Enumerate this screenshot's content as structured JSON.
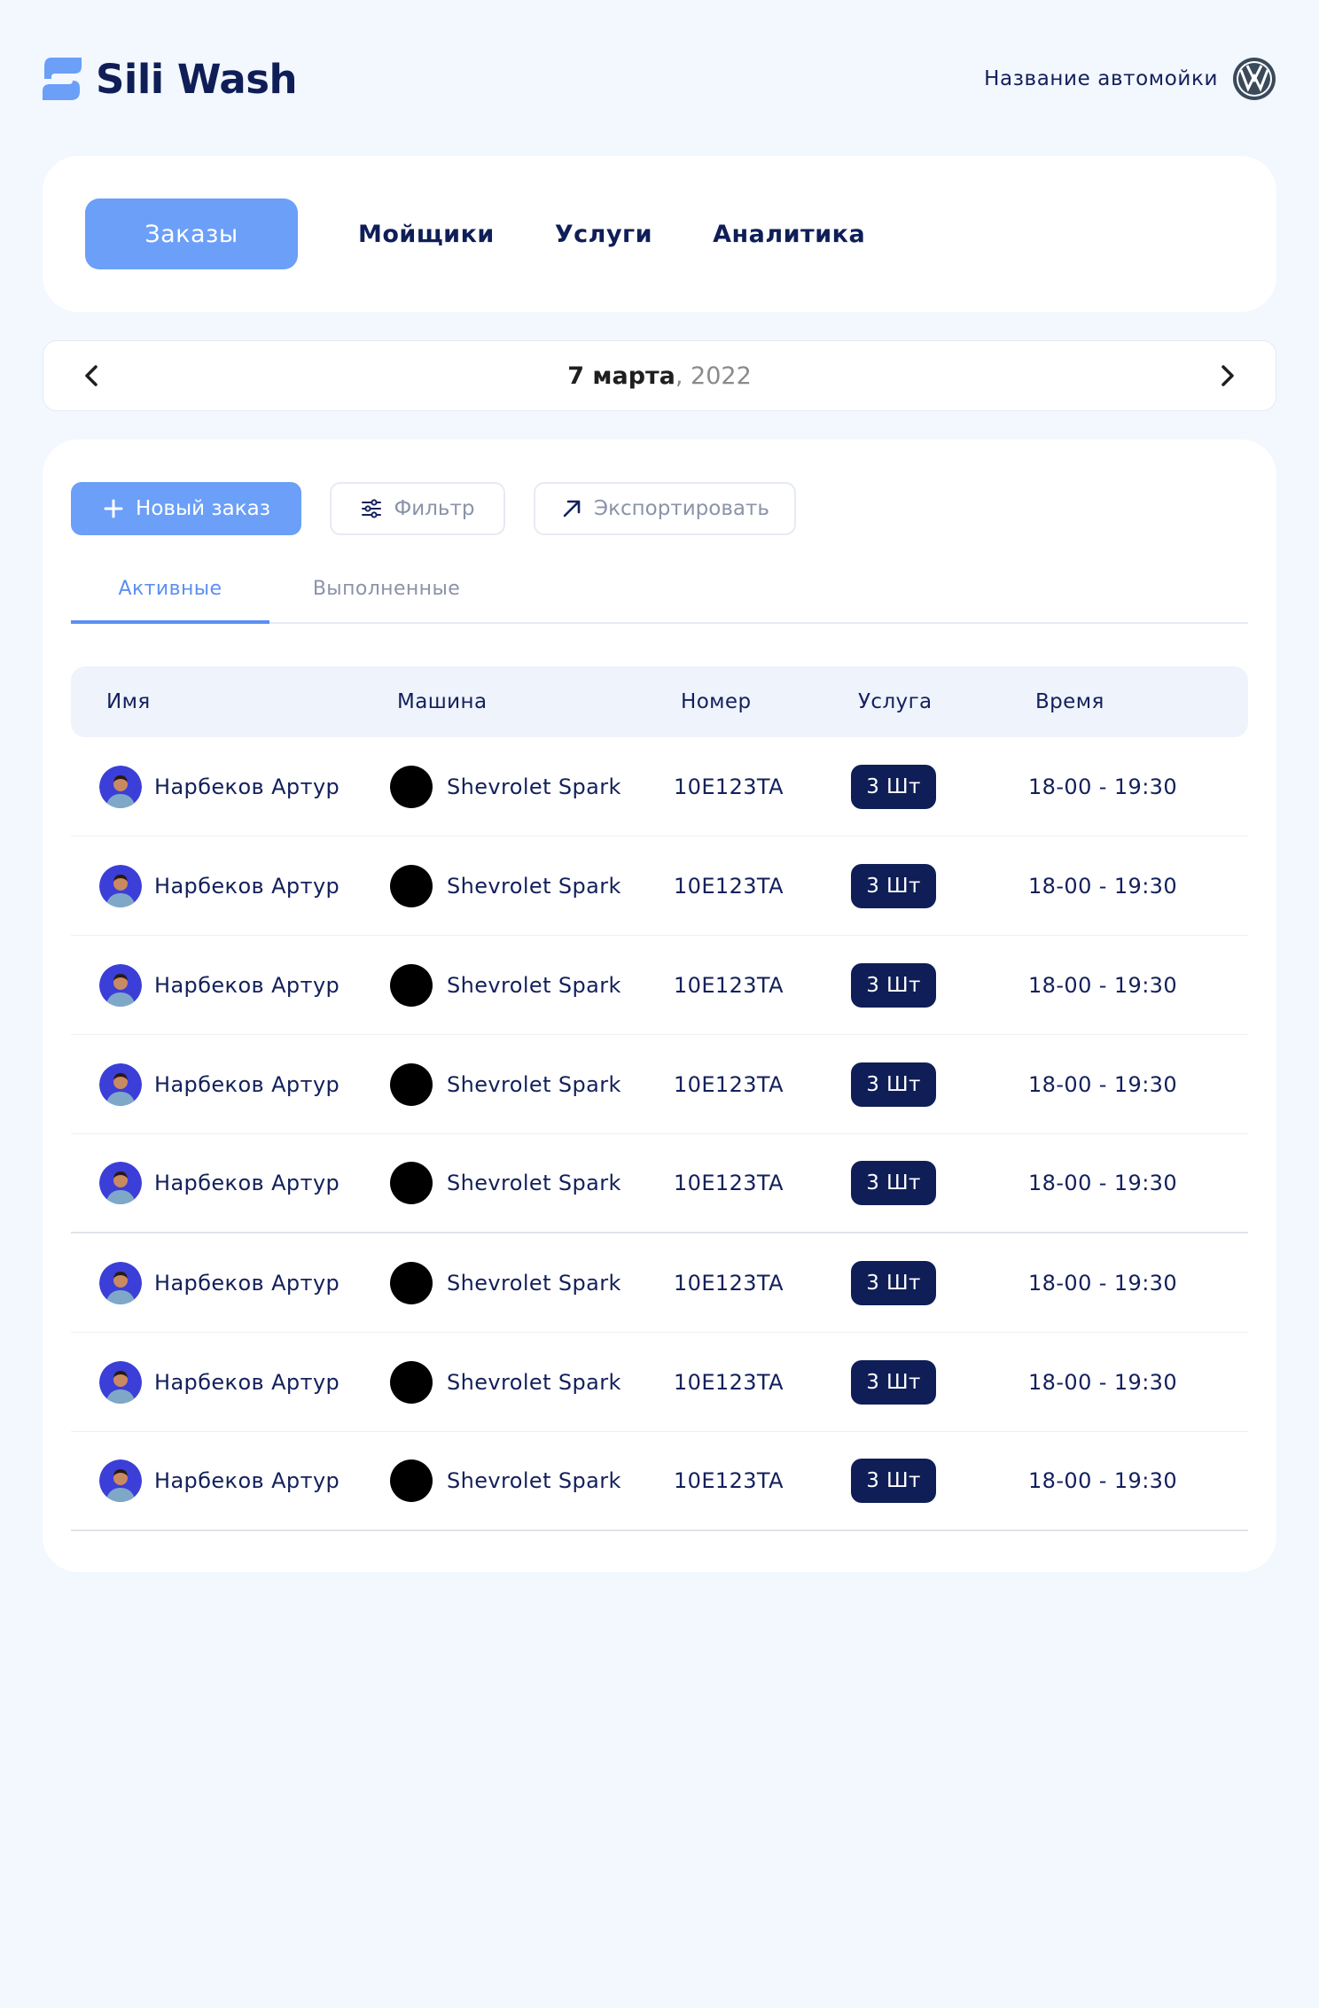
{
  "header": {
    "brand_name": "Sili Wash",
    "wash_name": "Название автомойки"
  },
  "nav": {
    "tabs": [
      "Заказы",
      "Мойщики",
      "Услуги",
      "Аналитика"
    ],
    "active": "Заказы"
  },
  "date": {
    "day": "7 марта",
    "year": ", 2022"
  },
  "toolbar": {
    "new_order": "Новый заказ",
    "filter": "Фильтр",
    "export": "Экспортировать"
  },
  "subtabs": [
    "Активные",
    "Выполненные"
  ],
  "table": {
    "headers": [
      "Имя",
      "Машина",
      "Номер",
      "Услуга",
      "Время"
    ],
    "rows": [
      {
        "name": "Нарбеков Артур",
        "car": "Shevrolet Spark",
        "number": "10E123TA",
        "service": "3 Шт",
        "time": "18-00 - 19:30"
      },
      {
        "name": "Нарбеков Артур",
        "car": "Shevrolet Spark",
        "number": "10E123TA",
        "service": "3 Шт",
        "time": "18-00 - 19:30"
      },
      {
        "name": "Нарбеков Артур",
        "car": "Shevrolet Spark",
        "number": "10E123TA",
        "service": "3 Шт",
        "time": "18-00 - 19:30"
      },
      {
        "name": "Нарбеков Артур",
        "car": "Shevrolet Spark",
        "number": "10E123TA",
        "service": "3 Шт",
        "time": "18-00 - 19:30"
      },
      {
        "name": "Нарбеков Артур",
        "car": "Shevrolet Spark",
        "number": "10E123TA",
        "service": "3 Шт",
        "time": "18-00 - 19:30"
      },
      {
        "name": "Нарбеков Артур",
        "car": "Shevrolet Spark",
        "number": "10E123TA",
        "service": "3 Шт",
        "time": "18-00 - 19:30"
      },
      {
        "name": "Нарбеков Артур",
        "car": "Shevrolet Spark",
        "number": "10E123TA",
        "service": "3 Шт",
        "time": "18-00 - 19:30"
      },
      {
        "name": "Нарбеков Артур",
        "car": "Shevrolet Spark",
        "number": "10E123TA",
        "service": "3 Шт",
        "time": "18-00 - 19:30"
      }
    ]
  },
  "colors": {
    "accent": "#6b9ff8",
    "navy": "#0f1e57",
    "background": "#f3f7fe"
  }
}
